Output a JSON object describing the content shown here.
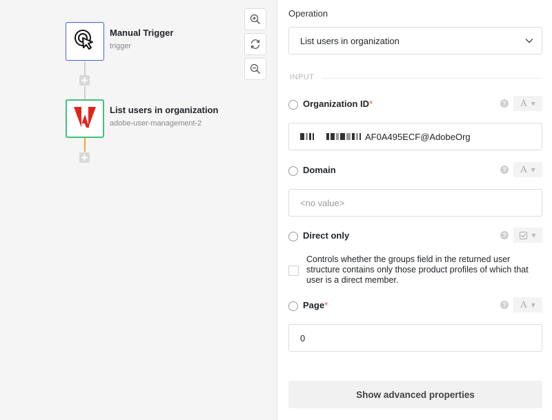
{
  "workflow": {
    "nodes": [
      {
        "title": "Manual Trigger",
        "subtitle": "trigger",
        "icon": "pointer-click-icon"
      },
      {
        "title": "List users in organization",
        "subtitle": "adobe-user-management-2",
        "icon": "adobe-logo-icon"
      }
    ],
    "connector_color": "#f5a623",
    "zoom_controls": [
      "zoom-in-icon",
      "reset-view-icon",
      "zoom-out-icon"
    ]
  },
  "panel": {
    "operation_label": "Operation",
    "operation_value": "List users in organization",
    "section_header": "INPUT",
    "fields": {
      "organization_id": {
        "label": "Organization ID",
        "required_mark": "*",
        "type_glyph": "A",
        "value": "AF0A495ECF@AdobeOrg"
      },
      "domain": {
        "label": "Domain",
        "type_glyph": "A",
        "placeholder": "<no value>"
      },
      "direct_only": {
        "label": "Direct only",
        "description": "Controls whether the groups field in the returned user structure contains only those product profiles of which that user is a direct member.",
        "checked": false
      },
      "page": {
        "label": "Page",
        "required_mark": "*",
        "type_glyph": "A",
        "value": "0"
      }
    },
    "help_glyph": "?",
    "advanced_button": "Show advanced properties"
  },
  "colors": {
    "trigger_border": "#3a63d8",
    "active_node_border": "#3fc07c",
    "adobe_red": "#e1251b",
    "required": "#e5484d"
  }
}
